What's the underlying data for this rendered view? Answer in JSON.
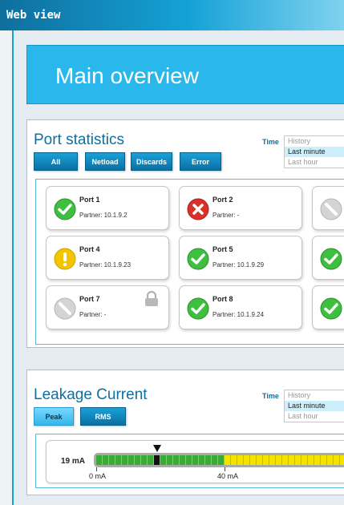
{
  "window": {
    "title": "Web view"
  },
  "banner": {
    "title": "Main overview"
  },
  "port_statistics": {
    "title": "Port statistics",
    "filters": [
      {
        "label": "All",
        "active": true
      },
      {
        "label": "Netload",
        "active": false
      },
      {
        "label": "Discards",
        "active": false
      },
      {
        "label": "Error",
        "active": false
      }
    ],
    "time": {
      "label": "Time",
      "options": [
        {
          "label": "History",
          "selected": false
        },
        {
          "label": "Last minute",
          "selected": true
        },
        {
          "label": "Last hour",
          "selected": false
        }
      ]
    },
    "ports": [
      {
        "name": "Port 1",
        "partner": "Partner: 10.1.9.2",
        "status": "ok",
        "status_icon": "check-icon"
      },
      {
        "name": "Port 2",
        "partner": "Partner: -",
        "status": "error",
        "status_icon": "error-x-icon"
      },
      {
        "name": "",
        "partner": "",
        "status": "disabled",
        "status_icon": "disabled-icon"
      },
      {
        "name": "Port 4",
        "partner": "Partner: 10.1.9.23",
        "status": "warning",
        "status_icon": "warning-icon"
      },
      {
        "name": "Port 5",
        "partner": "Partner: 10.1.9.29",
        "status": "ok",
        "status_icon": "check-icon"
      },
      {
        "name": "",
        "partner": "",
        "status": "ok",
        "status_icon": "check-icon"
      },
      {
        "name": "Port 7",
        "partner": "Partner: -",
        "status": "disabled",
        "status_icon": "disabled-icon",
        "locked": true
      },
      {
        "name": "Port 8",
        "partner": "Partner: 10.1.9.24",
        "status": "ok",
        "status_icon": "check-icon"
      },
      {
        "name": "",
        "partner": "",
        "status": "ok",
        "status_icon": "check-icon"
      }
    ]
  },
  "leakage_current": {
    "title": "Leakage Current",
    "filters": [
      {
        "label": "Peak",
        "active": true
      },
      {
        "label": "RMS",
        "active": false
      }
    ],
    "time": {
      "label": "Time",
      "options": [
        {
          "label": "History",
          "selected": false
        },
        {
          "label": "Last minute",
          "selected": true
        },
        {
          "label": "Last hour",
          "selected": false
        }
      ]
    },
    "meter": {
      "value_label": "19 mA",
      "value": 19,
      "ticks": [
        {
          "value": 0,
          "label": "0 mA"
        },
        {
          "value": 40,
          "label": "40 mA"
        }
      ],
      "green_until": 40
    }
  },
  "colors": {
    "accent": "#16a2d3",
    "ok": "#3fbf3f",
    "error": "#d9322a",
    "warning": "#f3c400",
    "disabled": "#c8c8c8",
    "meter_green": "#3aaa35",
    "meter_yellow": "#f2e300"
  }
}
